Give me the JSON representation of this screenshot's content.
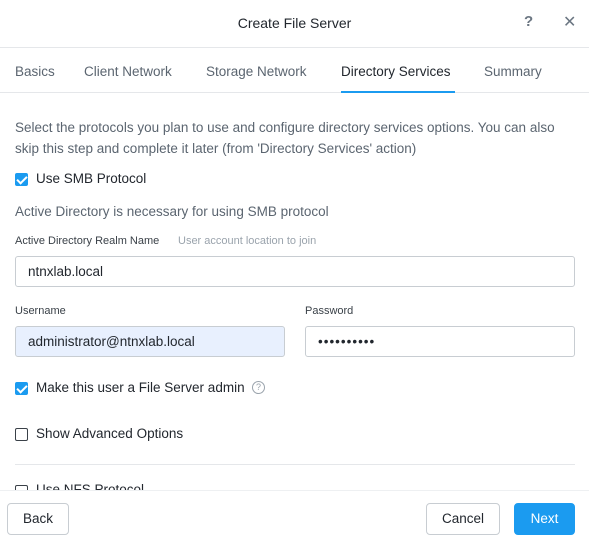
{
  "dialog": {
    "title": "Create File Server",
    "help_glyph": "?",
    "close_glyph": "✕"
  },
  "tabs": [
    {
      "label": "Basics",
      "active": false
    },
    {
      "label": "Client Network",
      "active": false
    },
    {
      "label": "Storage Network",
      "active": false
    },
    {
      "label": "Directory Services",
      "active": true
    },
    {
      "label": "Summary",
      "active": false
    }
  ],
  "content": {
    "intro": "Select the protocols you plan to use and configure directory services options. You can also skip this step and complete it later (from 'Directory Services' action)",
    "smb": {
      "label": "Use SMB Protocol",
      "checked": true
    },
    "ad_info": "Active Directory is necessary for using SMB protocol",
    "realm": {
      "label": "Active Directory Realm Name",
      "hint": "User account location to join",
      "value": "ntnxlab.local"
    },
    "username": {
      "label": "Username",
      "value": "administrator@ntnxlab.local"
    },
    "password": {
      "label": "Password",
      "value": "••••••••••"
    },
    "fs_admin": {
      "label": "Make this user a File Server admin",
      "checked": true,
      "help_glyph": "?"
    },
    "advanced": {
      "label": "Show Advanced Options",
      "checked": false
    },
    "nfs": {
      "label": "Use NFS Protocol",
      "checked": false
    }
  },
  "footer": {
    "back_label": "Back",
    "cancel_label": "Cancel",
    "next_label": "Next"
  },
  "colors": {
    "accent": "#1b9bf0",
    "autofill_bg": "#e8f0fe"
  },
  "icons": [
    "help-icon",
    "close-icon",
    "checkbox-checked-icon",
    "checkbox-unchecked-icon",
    "help-circle-icon"
  ]
}
